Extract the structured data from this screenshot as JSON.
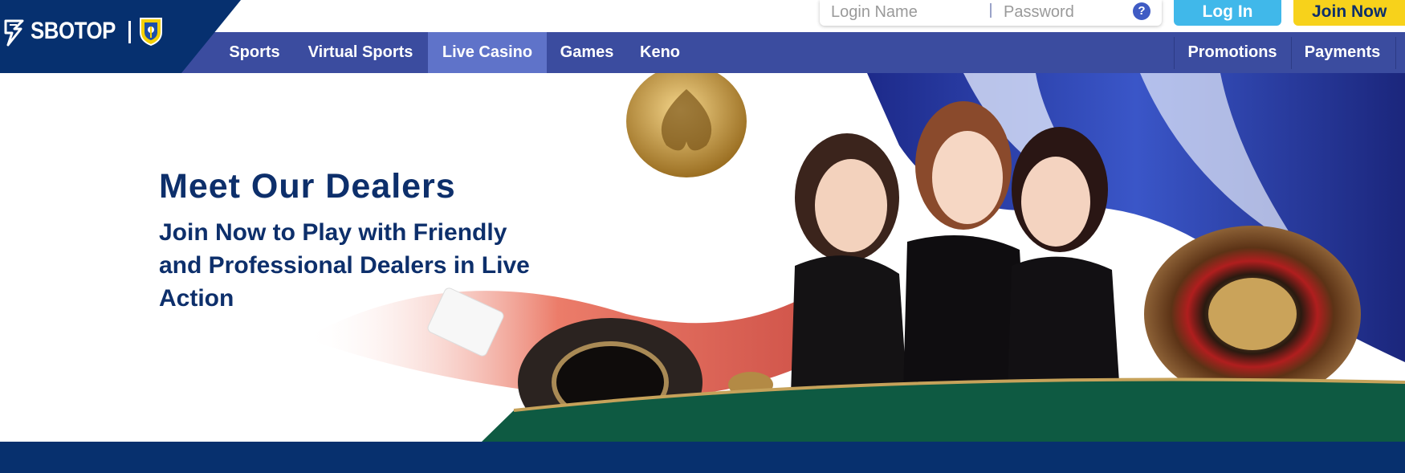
{
  "brand": {
    "name": "SBOTOP",
    "primary": "#06306f",
    "nav_bg": "#3b4c9f",
    "nav_active": "#5f73c9",
    "login_color": "#40b8ea",
    "join_color": "#f7d21b"
  },
  "login": {
    "username_placeholder": "Login Name",
    "password_placeholder": "Password",
    "help_icon": "?",
    "login_label": "Log In",
    "join_label": "Join Now"
  },
  "nav": {
    "items": [
      {
        "label": "Sports",
        "active": false
      },
      {
        "label": "Virtual Sports",
        "active": false
      },
      {
        "label": "Live Casino",
        "active": true
      },
      {
        "label": "Games",
        "active": false
      },
      {
        "label": "Keno",
        "active": false
      }
    ],
    "right_items": [
      {
        "label": "Promotions"
      },
      {
        "label": "Payments"
      }
    ]
  },
  "hero": {
    "title": "Meet Our Dealers",
    "subtitle": "Join Now to Play with Friendly and Professional Dealers in Live Action"
  },
  "icons": [
    "sbotop-logo-icon",
    "club-crest-icon",
    "help-icon"
  ]
}
